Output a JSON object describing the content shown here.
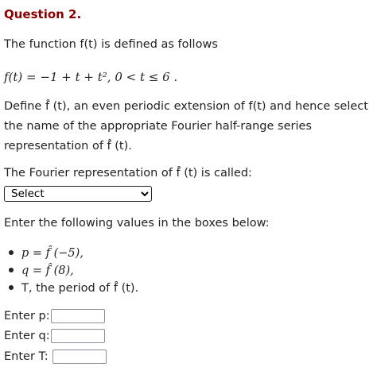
{
  "question": {
    "title": "Question 2."
  },
  "intro": {
    "text": "The function f(t) is defined as follows"
  },
  "definition": {
    "formula": "f(t) = −1 + t + t², 0 < t ≤ 6 ."
  },
  "instruction": {
    "text": "Define f̂ (t), an even periodic extension of f(t) and hence select the name of the appropriate Fourier half-range series representation of f̂ (t)."
  },
  "representation": {
    "label": "The Fourier representation of f̂ (t) is called:",
    "select_value": "Select"
  },
  "values_prompt": {
    "text": "Enter the following values in the boxes below:"
  },
  "bullets": [
    {
      "text": "p = f̂ (−5),"
    },
    {
      "text": "q = f̂ (8),"
    },
    {
      "text": "T, the period of f̂ (t)."
    }
  ],
  "inputs": {
    "p_label": "Enter p:",
    "q_label": "Enter q:",
    "t_label": "Enter T:",
    "p_value": "",
    "q_value": "",
    "t_value": ""
  }
}
